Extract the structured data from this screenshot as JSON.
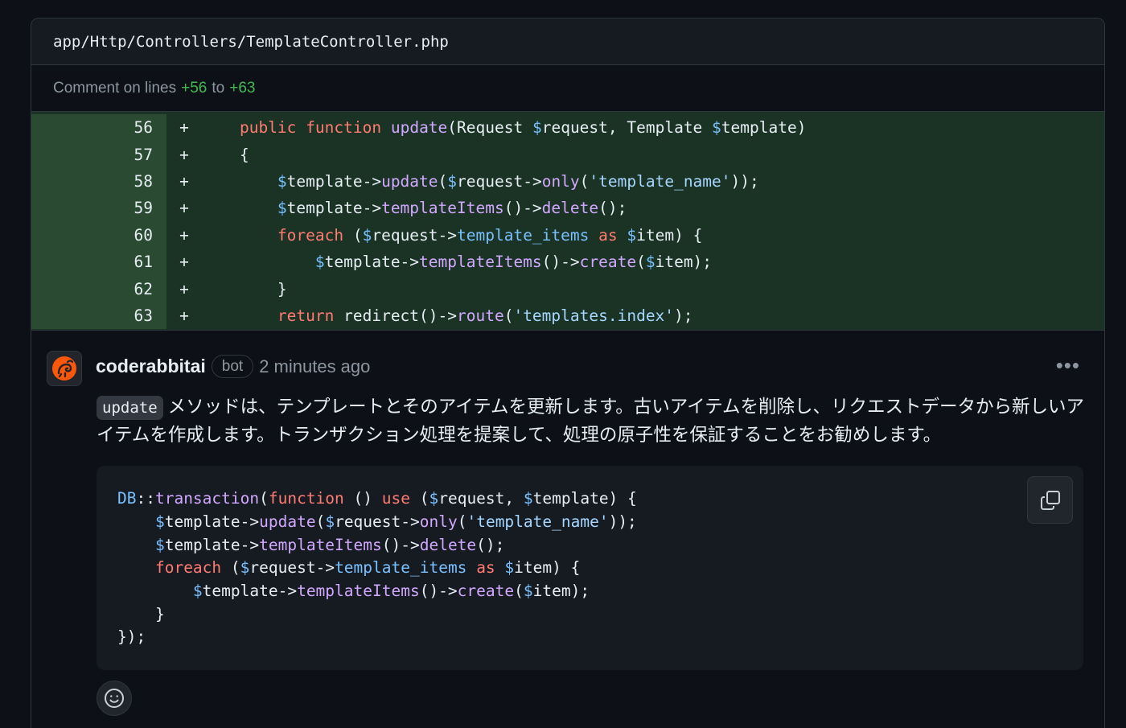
{
  "file": {
    "path": "app/Http/Controllers/TemplateController.php"
  },
  "comment_range": {
    "prefix": "Comment on lines",
    "start": "+56",
    "middle": "to",
    "end": "+63"
  },
  "diff": {
    "sign": "+",
    "lines": [
      {
        "num": "56"
      },
      {
        "num": "57"
      },
      {
        "num": "58"
      },
      {
        "num": "59"
      },
      {
        "num": "60"
      },
      {
        "num": "61"
      },
      {
        "num": "62"
      },
      {
        "num": "63"
      }
    ]
  },
  "comment": {
    "author": "coderabbitai",
    "badge": "bot",
    "time": "2 minutes ago",
    "more": "•••",
    "inline_code": "update",
    "text": "メソッドは、テンプレートとそのアイテムを更新します。古いアイテムを削除し、リクエストデータから新しいアイテムを作成します。トランザクション処理を提案して、処理の原子性を保証することをお勧めします。"
  },
  "icons": {
    "avatar": "coderabbit-logo",
    "copy": "copy-icon",
    "reaction": "smiley-icon",
    "more": "kebab-horizontal-icon"
  },
  "colors": {
    "background": "#0d1117",
    "diff_added": "#1b3325",
    "line_number_added": "#2a4a32",
    "accent_green": "#3fb950",
    "keyword": "#ff7b72",
    "function": "#d2a8ff",
    "variable": "#79c0ff",
    "string": "#a5d6ff"
  }
}
